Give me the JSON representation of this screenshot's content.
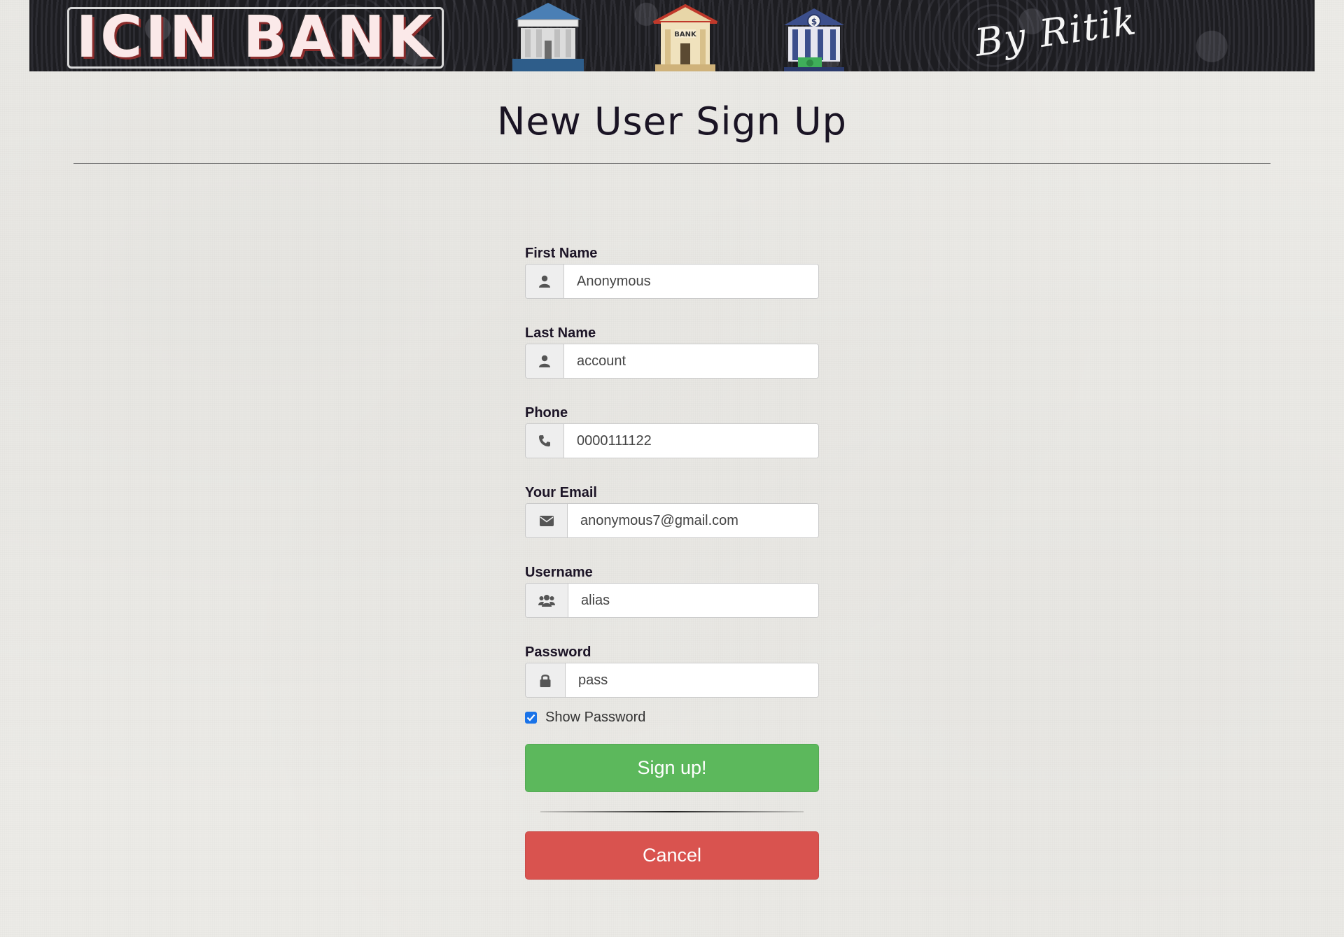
{
  "banner": {
    "logo_text": "ICIN BANK",
    "icons": [
      "bank-building-icon",
      "bank-house-icon",
      "bank-money-icon"
    ],
    "bank_sign": "BANK",
    "signature": "By Ritik"
  },
  "page": {
    "title": "New User Sign Up"
  },
  "form": {
    "first_name": {
      "label": "First Name",
      "value": "Anonymous",
      "icon": "user-icon"
    },
    "last_name": {
      "label": "Last Name",
      "value": "account",
      "icon": "user-icon"
    },
    "phone": {
      "label": "Phone",
      "value": "0000111122",
      "icon": "phone-icon"
    },
    "email": {
      "label": "Your Email",
      "value": "anonymous7@gmail.com",
      "icon": "envelope-icon"
    },
    "username": {
      "label": "Username",
      "value": "alias",
      "icon": "users-icon"
    },
    "password": {
      "label": "Password",
      "value": "pass",
      "icon": "lock-icon"
    },
    "show_password": {
      "label": "Show Password",
      "checked": true
    }
  },
  "buttons": {
    "signup": "Sign up!",
    "cancel": "Cancel"
  },
  "colors": {
    "signup": "#5cb85c",
    "cancel": "#d9534f",
    "checkbox": "#1a73e8"
  }
}
